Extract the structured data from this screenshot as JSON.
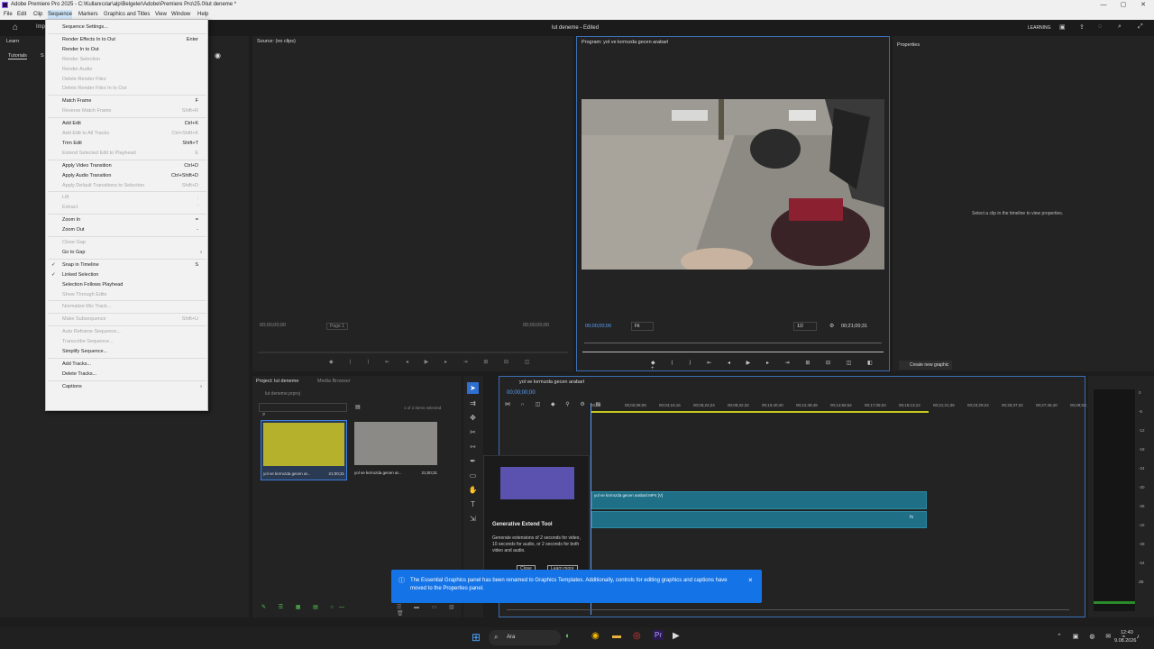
{
  "window": {
    "title": "Adobe Premiere Pro 2025 - C:\\Kullanıcılar\\alp\\Belgeler\\Adobe\\Premiere Pro\\25.0\\lut deneme *"
  },
  "menubar": [
    "File",
    "Edit",
    "Clip",
    "Sequence",
    "Markers",
    "Graphics and Titles",
    "View",
    "Window",
    "Help"
  ],
  "header": {
    "project_title": "lut deneme - Edited",
    "learning": "LEARNING"
  },
  "left_panel": {
    "learn_tab": "Learn",
    "tutorials_tab": "Tutorials",
    "import_tab": "Imp",
    "s_tab": "S"
  },
  "sequence_menu": [
    {
      "label": "Sequence Settings...",
      "shortcut": "",
      "enabled": true
    },
    {
      "sep": true
    },
    {
      "label": "Render Effects In to Out",
      "shortcut": "Enter",
      "enabled": true
    },
    {
      "label": "Render In to Out",
      "shortcut": "",
      "enabled": true
    },
    {
      "label": "Render Selection",
      "shortcut": "",
      "enabled": false
    },
    {
      "label": "Render Audio",
      "shortcut": "",
      "enabled": false
    },
    {
      "label": "Delete Render Files",
      "shortcut": "",
      "enabled": false
    },
    {
      "label": "Delete Render Files In to Out",
      "shortcut": "",
      "enabled": false
    },
    {
      "sep": true
    },
    {
      "label": "Match Frame",
      "shortcut": "F",
      "enabled": true
    },
    {
      "label": "Reverse Match Frame",
      "shortcut": "Shift+R",
      "enabled": false
    },
    {
      "sep": true
    },
    {
      "label": "Add Edit",
      "shortcut": "Ctrl+K",
      "enabled": true
    },
    {
      "label": "Add Edit to All Tracks",
      "shortcut": "Ctrl+Shift+K",
      "enabled": false
    },
    {
      "label": "Trim Edit",
      "shortcut": "Shift+T",
      "enabled": true
    },
    {
      "label": "Extend Selected Edit to Playhead",
      "shortcut": "E",
      "enabled": false
    },
    {
      "sep": true
    },
    {
      "label": "Apply Video Transition",
      "shortcut": "Ctrl+D",
      "enabled": true
    },
    {
      "label": "Apply Audio Transition",
      "shortcut": "Ctrl+Shift+D",
      "enabled": true
    },
    {
      "label": "Apply Default Transitions to Selection",
      "shortcut": "Shift+D",
      "enabled": false
    },
    {
      "sep": true
    },
    {
      "label": "Lift",
      "shortcut": ";",
      "enabled": false
    },
    {
      "label": "Extract",
      "shortcut": "'",
      "enabled": false
    },
    {
      "sep": true
    },
    {
      "label": "Zoom In",
      "shortcut": "=",
      "enabled": true
    },
    {
      "label": "Zoom Out",
      "shortcut": "-",
      "enabled": true
    },
    {
      "sep": true
    },
    {
      "label": "Close Gap",
      "shortcut": "",
      "enabled": false
    },
    {
      "label": "Go to Gap",
      "shortcut": "",
      "enabled": true,
      "submenu": true
    },
    {
      "sep": true
    },
    {
      "label": "Snap in Timeline",
      "shortcut": "S",
      "enabled": true,
      "checked": true
    },
    {
      "label": "Linked Selection",
      "shortcut": "",
      "enabled": true,
      "checked": true
    },
    {
      "label": "Selection Follows Playhead",
      "shortcut": "",
      "enabled": true
    },
    {
      "label": "Show Through Edits",
      "shortcut": "",
      "enabled": false
    },
    {
      "sep": true
    },
    {
      "label": "Normalize Mix Track...",
      "shortcut": "",
      "enabled": false
    },
    {
      "sep": true
    },
    {
      "label": "Make Subsequence",
      "shortcut": "Shift+U",
      "enabled": false
    },
    {
      "sep": true
    },
    {
      "label": "Auto Reframe Sequence...",
      "shortcut": "",
      "enabled": false
    },
    {
      "label": "Transcribe Sequence...",
      "shortcut": "",
      "enabled": false
    },
    {
      "label": "Simplify Sequence...",
      "shortcut": "",
      "enabled": true
    },
    {
      "sep": true
    },
    {
      "label": "Add Tracks...",
      "shortcut": "",
      "enabled": true
    },
    {
      "label": "Delete Tracks...",
      "shortcut": "",
      "enabled": true
    },
    {
      "sep": true
    },
    {
      "label": "Captions",
      "shortcut": "",
      "enabled": true,
      "submenu": true
    }
  ],
  "source_monitor": {
    "title": "Source: (no clips)",
    "tc_left": "00;00;00;00",
    "page": "Page 1",
    "tc_right": "00;00;00;00"
  },
  "program_monitor": {
    "title": "Program: yol ve kırmızda gecen arabarl",
    "tc_left": "00;00;00;00",
    "fit": "Fit",
    "ratio": "1/2",
    "tc_right": "00;21;00;31"
  },
  "properties": {
    "title": "Properties",
    "hint": "Select a clip in the timeline to view properties.",
    "create_btn": "Create new graphic"
  },
  "project": {
    "tab": "Project: lut deneme",
    "media_tab": "Media Browser",
    "file": "lut deneme.prproj",
    "count": "1 of 2 items selected",
    "items": [
      {
        "name": "yol ve kırmızda gecen ar...",
        "dur": "21;00;31"
      },
      {
        "name": "yol ve kırmızda gecen ar...",
        "dur": "21;00;31"
      }
    ]
  },
  "timeline": {
    "tab": "yol ve kırmızda gecen arabarl",
    "tc": "00;00;00;00",
    "ticks": [
      "00;00",
      "00;02;08;08",
      "00;04;16;16",
      "00;06;24;24",
      "00;08;32;32",
      "00;10;40;40",
      "00;12;48;48",
      "00;14;56;52",
      "00;17;05;04",
      "00;19;13;12",
      "00;21;21;36",
      "00;23;29;24",
      "00;25;37;32",
      "00;27;45;40",
      "00;29;53;"
    ],
    "clip_label": "yol ve kırmızda gecen arabarl.MP4 [V]",
    "audio_label": "fx"
  },
  "tooltip": {
    "title": "Generative Extend Tool",
    "body": "Generate extensions of 2 seconds for video, 10 seconds for audio, or 2 seconds for both video and audio.",
    "close": "Close",
    "learn": "Learn more"
  },
  "banner": {
    "text": "The Essential Graphics panel has been renamed to Graphics Templates. Additionally, controls for editing graphics and captions have moved to the Properties panel.",
    "close": "×"
  },
  "meter_labels": [
    "0",
    "-6",
    "-12",
    "-18",
    "-24",
    "-30",
    "-36",
    "-42",
    "-48",
    "-54",
    "dB"
  ],
  "taskbar": {
    "search": "Ara",
    "time": "12:40",
    "date": "9.08.2026"
  }
}
